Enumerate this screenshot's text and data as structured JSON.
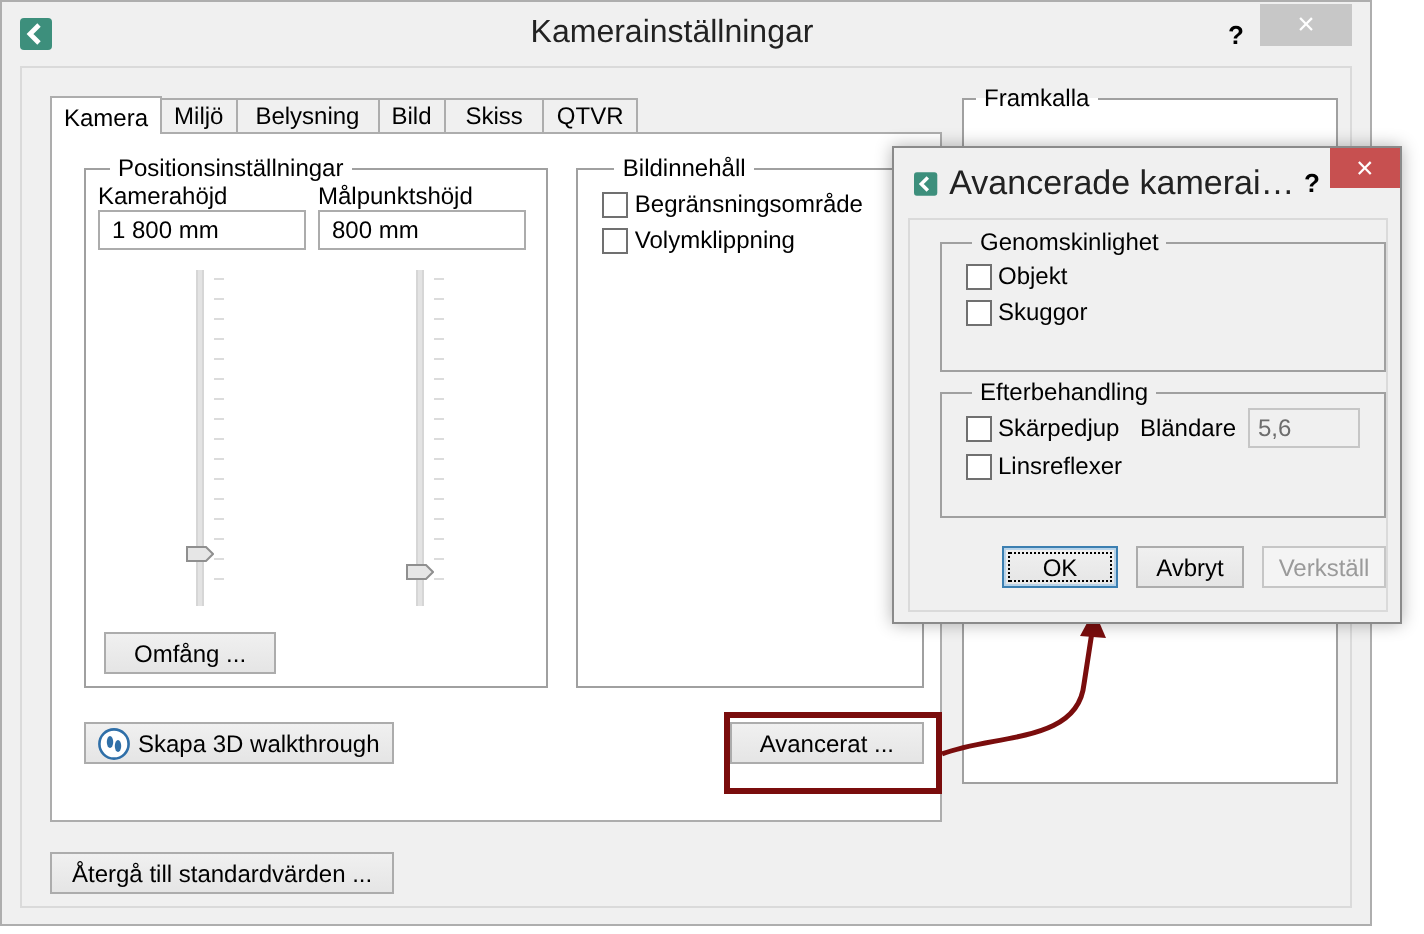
{
  "window": {
    "title": "Kamerainställningar",
    "help": "?",
    "close": "×"
  },
  "tabs": [
    {
      "label": "Kamera",
      "selected": true
    },
    {
      "label": "Miljö",
      "selected": false
    },
    {
      "label": "Belysning",
      "selected": false
    },
    {
      "label": "Bild",
      "selected": false
    },
    {
      "label": "Skiss",
      "selected": false
    },
    {
      "label": "QTVR",
      "selected": false
    }
  ],
  "position_group": {
    "title": "Positionsinställningar",
    "fields": [
      {
        "label": "Kamerahöjd",
        "value": "1 800 mm",
        "level": 0.14
      },
      {
        "label": "Målpunktshöjd",
        "value": "800 mm",
        "level": 0.08
      }
    ],
    "range_button": "Omfång ..."
  },
  "image_content_group": {
    "title": "Bildinnehåll",
    "options": [
      {
        "label": "Begränsningsområde",
        "checked": false
      },
      {
        "label": "Volymklippning",
        "checked": false
      }
    ]
  },
  "walkthrough_button": "Skapa 3D walkthrough",
  "advanced_button": "Avancerat ...",
  "develop_group": {
    "title": "Framkalla"
  },
  "reset_button": "Återgå till standardvärden ...",
  "advanced_dialog": {
    "title": "Avancerade kamerai…",
    "help": "?",
    "close": "×",
    "transparency": {
      "title": "Genomskinlighet",
      "options": [
        {
          "label": "Objekt",
          "checked": false
        },
        {
          "label": "Skuggor",
          "checked": false
        }
      ]
    },
    "post_processing": {
      "title": "Efterbehandling",
      "options": [
        {
          "label": "Skärpedjup",
          "checked": false
        },
        {
          "label": "Linsreflexer",
          "checked": false
        }
      ],
      "aperture": {
        "label": "Bländare",
        "value": "5,6",
        "disabled": true
      }
    },
    "buttons": [
      {
        "label": "OK",
        "default": true,
        "disabled": false
      },
      {
        "label": "Avbryt",
        "default": false,
        "disabled": false
      },
      {
        "label": "Verkställ",
        "default": false,
        "disabled": true
      }
    ]
  }
}
